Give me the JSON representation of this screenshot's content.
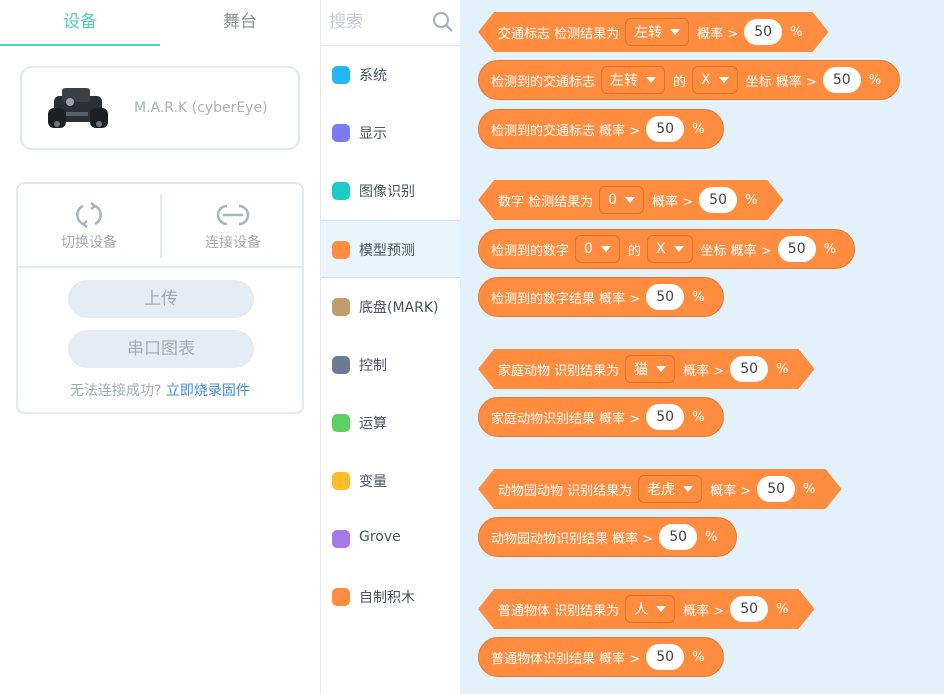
{
  "tabs": [
    {
      "label": "设备",
      "active": true
    },
    {
      "label": "舞台",
      "active": false
    }
  ],
  "device": {
    "name": "M.A.R.K (cyberEye)"
  },
  "actions": {
    "switch_label": "切换设备",
    "connect_label": "连接设备",
    "upload_label": "上传",
    "serial_label": "串口图表",
    "help_text": "无法连接成功?",
    "help_link": "立即烧录固件"
  },
  "search": {
    "placeholder": "搜索"
  },
  "categories": [
    {
      "label": "系统",
      "color": "#23b6f0"
    },
    {
      "label": "显示",
      "color": "#7b7cf5"
    },
    {
      "label": "图像识别",
      "color": "#1ccbc4"
    },
    {
      "label": "模型预测",
      "color": "#ff8c3f",
      "selected": true
    },
    {
      "label": "底盘(MARK)",
      "color": "#c29c6c"
    },
    {
      "label": "控制",
      "color": "#6e7a94"
    },
    {
      "label": "运算",
      "color": "#5fcf62"
    },
    {
      "label": "变量",
      "color": "#ffbd2a"
    },
    {
      "label": "Grove",
      "color": "#a779e6"
    },
    {
      "label": "自制积木",
      "color": "#ff8c3f"
    }
  ],
  "blocks": [
    {
      "parts": [
        "交通标志 检测结果为",
        "左转",
        "概率 >",
        "50",
        "%"
      ]
    },
    {
      "parts": [
        "检测到的交通标志",
        "左转",
        "的",
        "X",
        "坐标 概率 >",
        "50",
        "%"
      ]
    },
    {
      "parts": [
        "检测到的交通标志 概率 >",
        "50",
        "%"
      ]
    },
    {
      "parts": [
        "数字 检测结果为",
        "0",
        "概率 >",
        "50",
        "%"
      ]
    },
    {
      "parts": [
        "检测到的数字",
        "0",
        "的",
        "X",
        "坐标 概率 >",
        "50",
        "%"
      ]
    },
    {
      "parts": [
        "检测到的数字结果 概率 >",
        "50",
        "%"
      ]
    },
    {
      "parts": [
        "家庭动物 识别结果为",
        "猫",
        "概率 >",
        "50",
        "%"
      ]
    },
    {
      "parts": [
        "家庭动物识别结果 概率 >",
        "50",
        "%"
      ]
    },
    {
      "parts": [
        "动物园动物 识别结果为",
        "老虎",
        "概率 >",
        "50",
        "%"
      ]
    },
    {
      "parts": [
        "动物园动物识别结果 概率 >",
        "50",
        "%"
      ]
    },
    {
      "parts": [
        "普通物体 识别结果为",
        "人",
        "概率 >",
        "50",
        "%"
      ]
    },
    {
      "parts": [
        "普通物体识别结果 概率 >",
        "50",
        "%"
      ]
    }
  ]
}
